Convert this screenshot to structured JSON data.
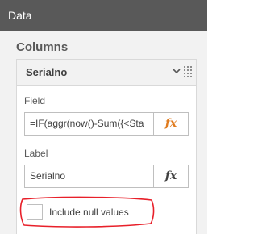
{
  "header": {
    "title": "Data"
  },
  "columns": {
    "section_title": "Columns",
    "card": {
      "title": "Serialno",
      "field_label": "Field",
      "field_value": "=IF(aggr(now()-Sum({<Sta",
      "fx_label": "fx",
      "label_label": "Label",
      "label_value": "Serialno",
      "include_null_label": "Include null values",
      "include_null_checked": false
    }
  },
  "icons": {
    "collapse": "chevron-down-icon",
    "drag": "drag-handle-icon",
    "expression": "fx-icon"
  },
  "colors": {
    "header_bg": "#595959",
    "fx_accent": "#e07b1e",
    "annotation": "#e8202a"
  }
}
